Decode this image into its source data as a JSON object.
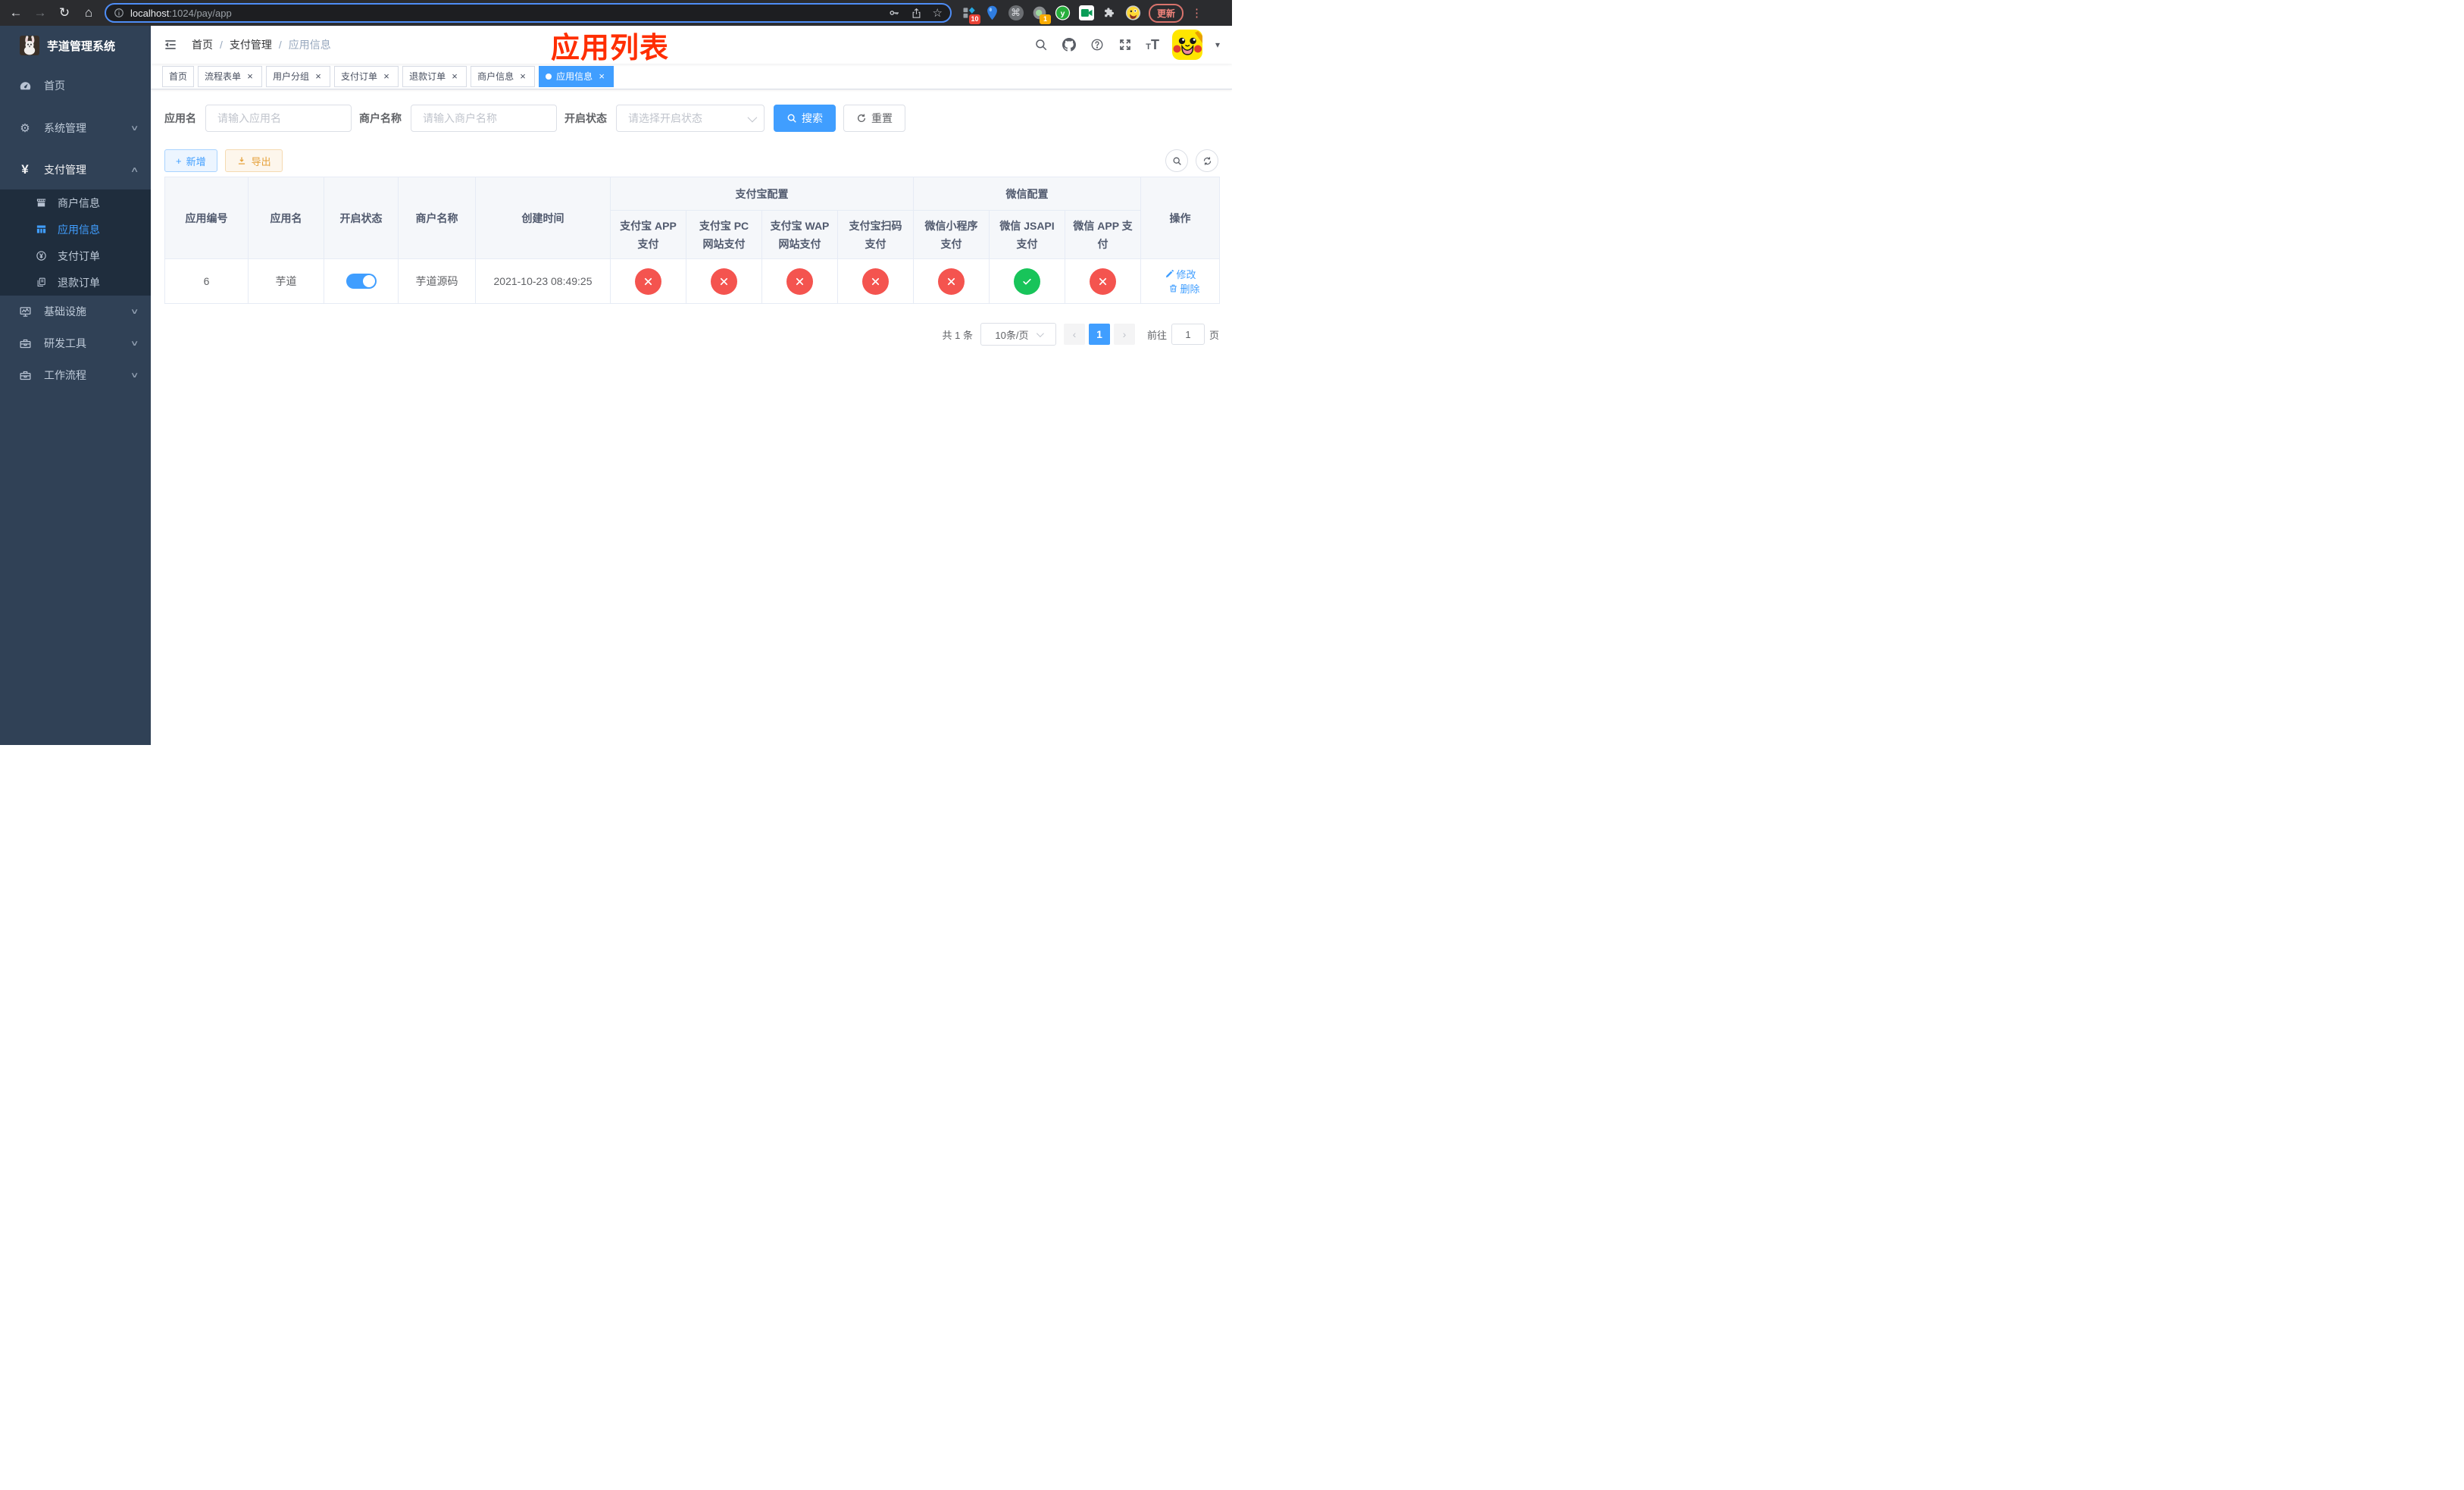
{
  "colors": {
    "accent": "#409eff",
    "success": "#18c45a",
    "danger": "#f4544f",
    "warning": "#e6a23c",
    "annotation_red": "#ff2e00",
    "sidebar_bg": "#304156",
    "submenu_bg": "#1f2d3d",
    "update_red": "#f1847c"
  },
  "icons": {
    "back": "←",
    "forward": "→",
    "reload": "↻",
    "home": "⌂",
    "star": "☆",
    "command": "⌘",
    "kebab": "⋮",
    "yen": "¥",
    "gear": "⚙",
    "chevron_down": "∨",
    "chevron_up": "∧",
    "close": "×",
    "plus": "+",
    "page_prev": "‹",
    "page_next": "›",
    "font_small": "T",
    "font_big": "T",
    "caret_down": "▾",
    "ext_letter": "y"
  },
  "browser": {
    "url_domain": "localhost",
    "url_path": ":1024/pay/app",
    "update_label": "更新",
    "badge_extensions": "10",
    "badge_recorder": "1"
  },
  "sidebar": {
    "logo_title": "芋道管理系统",
    "menu": [
      {
        "label": "首页"
      },
      {
        "label": "系统管理"
      },
      {
        "label": "支付管理"
      },
      {
        "label": "商户信息"
      },
      {
        "label": "应用信息"
      },
      {
        "label": "支付订单"
      },
      {
        "label": "退款订单"
      },
      {
        "label": "基础设施"
      },
      {
        "label": "研发工具"
      },
      {
        "label": "工作流程"
      }
    ]
  },
  "navbar": {
    "breadcrumb": [
      "首页",
      "支付管理",
      "应用信息"
    ],
    "annotation": "应用列表"
  },
  "tabs": [
    {
      "label": "首页"
    },
    {
      "label": "流程表单"
    },
    {
      "label": "用户分组"
    },
    {
      "label": "支付订单"
    },
    {
      "label": "退款订单"
    },
    {
      "label": "商户信息"
    },
    {
      "label": "应用信息"
    }
  ],
  "filters": {
    "app_name_label": "应用名",
    "app_name_placeholder": "请输入应用名",
    "merchant_label": "商户名称",
    "merchant_placeholder": "请输入商户名称",
    "status_label": "开启状态",
    "status_placeholder": "请选择开启状态",
    "search_label": "搜索",
    "reset_label": "重置"
  },
  "toolbar": {
    "add_label": "新增",
    "export_label": "导出"
  },
  "table": {
    "group_alipay": "支付宝配置",
    "group_wechat": "微信配置",
    "col_app_id": "应用编号",
    "col_app_name": "应用名",
    "col_status": "开启状态",
    "col_merchant": "商户名称",
    "col_created": "创建时间",
    "col_alipay_app": "支付宝 APP 支付",
    "col_alipay_pc": "支付宝 PC 网站支付",
    "col_alipay_wap": "支付宝 WAP 网站支付",
    "col_alipay_qr": "支付宝扫码支付",
    "col_wx_lite": "微信小程序支付",
    "col_wx_jsapi": "微信 JSAPI 支付",
    "col_wx_app": "微信 APP 支付",
    "col_actions": "操作",
    "rows": [
      {
        "app_id": "6",
        "app_name": "芋道",
        "status_enabled": true,
        "merchant": "芋道源码",
        "created": "2021-10-23 08:49:25",
        "channels": {
          "alipay_app": false,
          "alipay_pc": false,
          "alipay_wap": false,
          "alipay_qr": false,
          "wx_lite": false,
          "wx_jsapi": true,
          "wx_app": false
        },
        "edit_label": "修改",
        "delete_label": "删除"
      }
    ]
  },
  "pagination": {
    "total_label": "共 1 条",
    "page_size_label": "10条/页",
    "current_page": "1",
    "goto_label": "前往",
    "goto_value": "1",
    "page_suffix": "页"
  }
}
